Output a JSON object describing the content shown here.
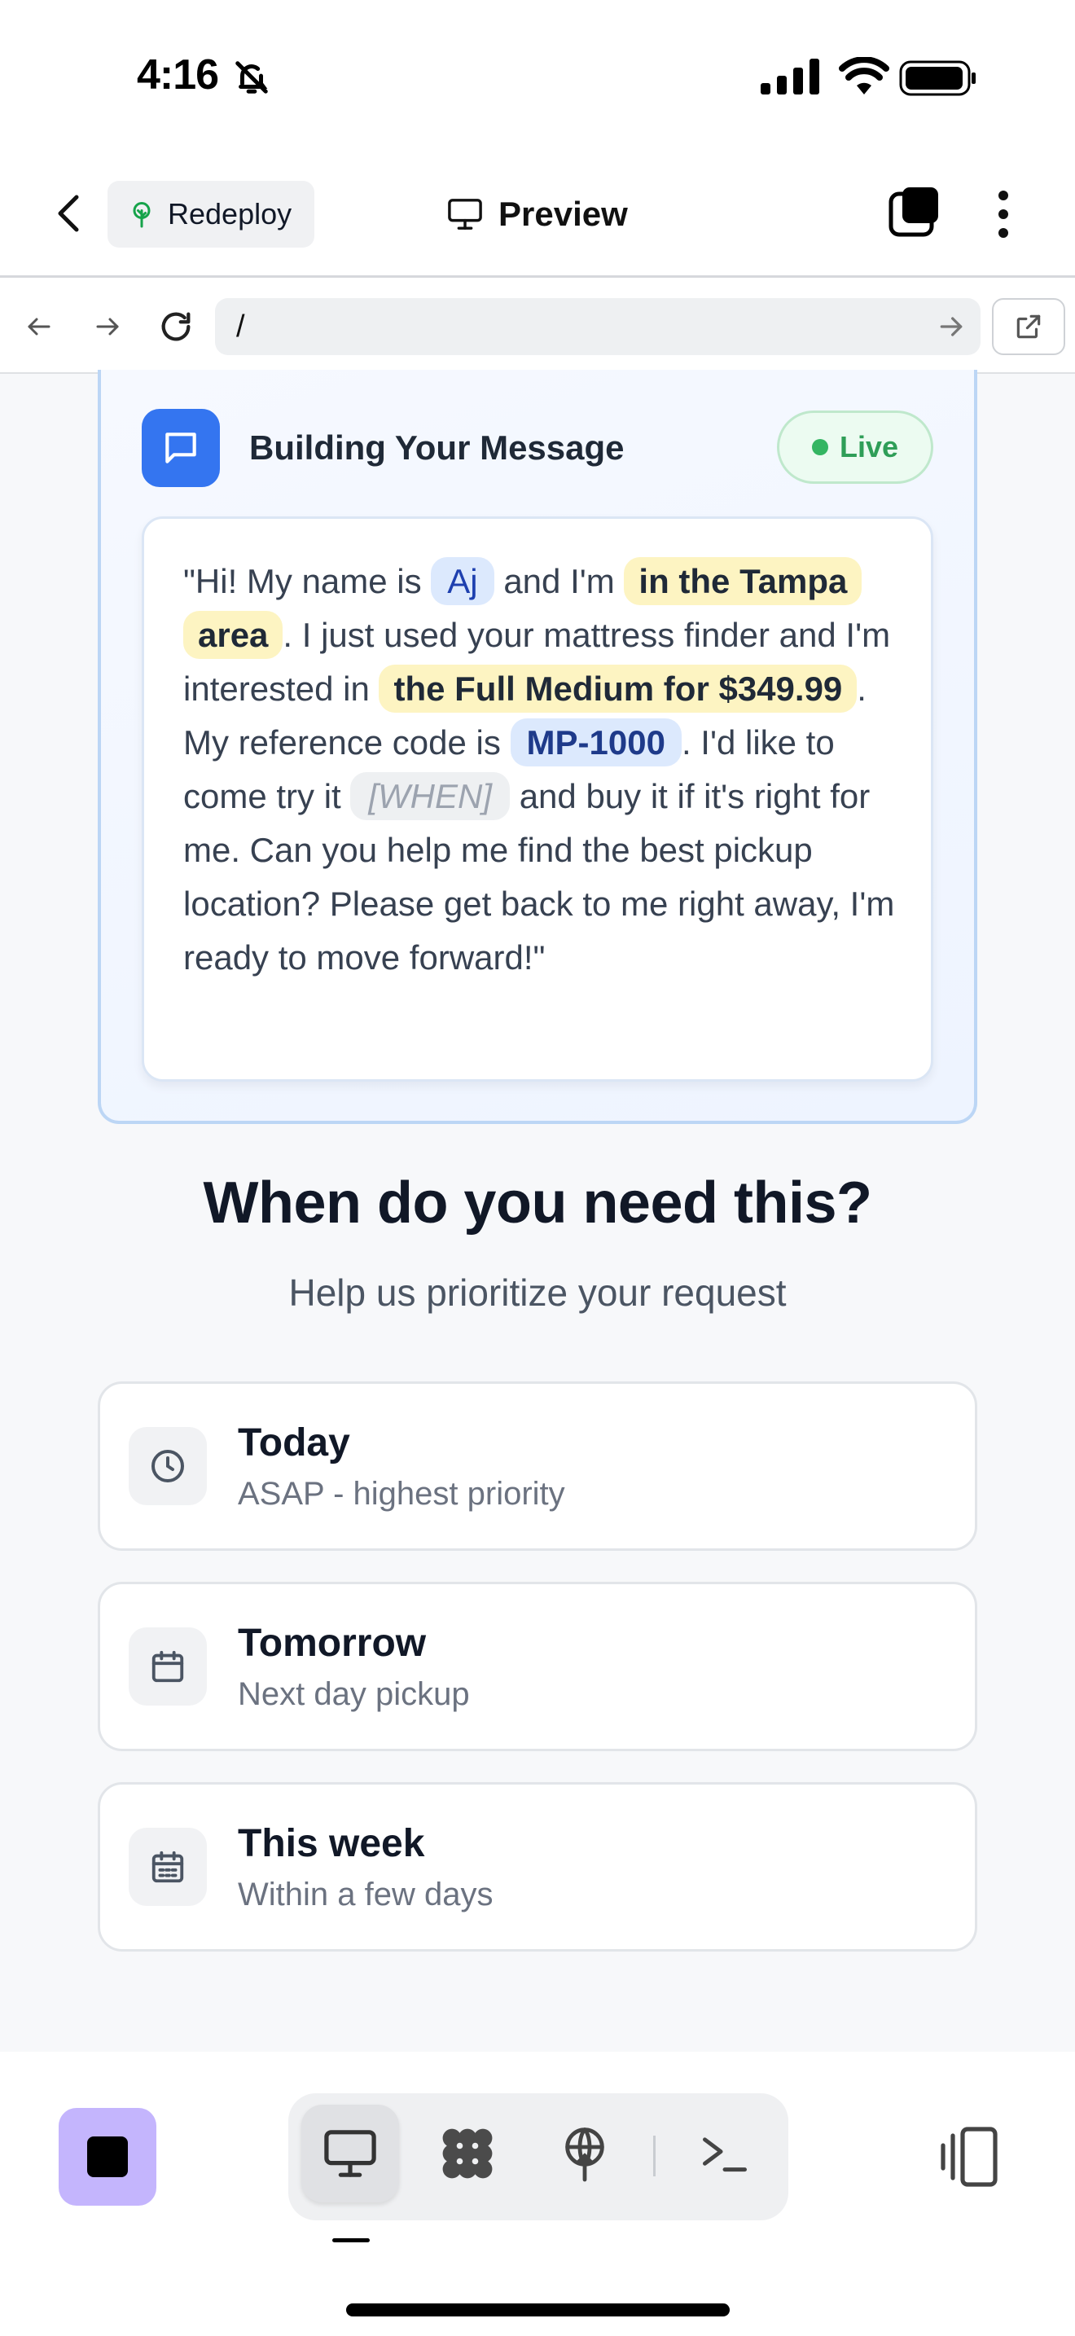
{
  "status_bar": {
    "time": "4:16"
  },
  "header": {
    "redeploy_label": "Redeploy",
    "title": "Preview"
  },
  "browser": {
    "url": "/"
  },
  "message_card": {
    "title": "Building Your Message",
    "live_label": "Live",
    "text": {
      "p1": "\"Hi! My name is ",
      "name": "Aj",
      "p2": " and I'm ",
      "location": "in the Tampa area",
      "p3": ". I just used your mattress finder and I'm interested in ",
      "product": "the Full Medium for $349.99",
      "p4": ". My reference code is ",
      "code": "MP-1000",
      "p5": ". I'd like to come try it ",
      "when": "[WHEN]",
      "p6": " and buy it if it's right for me. Can you help me find the best pickup location? Please get back to me right away, I'm ready to move forward!\""
    }
  },
  "question": {
    "title": "When do you need this?",
    "subtitle": "Help us prioritize your request",
    "options": [
      {
        "title": "Today",
        "subtitle": "ASAP - highest priority",
        "icon": "clock-icon"
      },
      {
        "title": "Tomorrow",
        "subtitle": "Next day pickup",
        "icon": "calendar-icon"
      },
      {
        "title": "This week",
        "subtitle": "Within a few days",
        "icon": "calendar-days-icon"
      }
    ]
  },
  "colors": {
    "accent_blue": "#3475f0",
    "live_green": "#2f9e58",
    "stop_purple": "#c4b5fd"
  }
}
